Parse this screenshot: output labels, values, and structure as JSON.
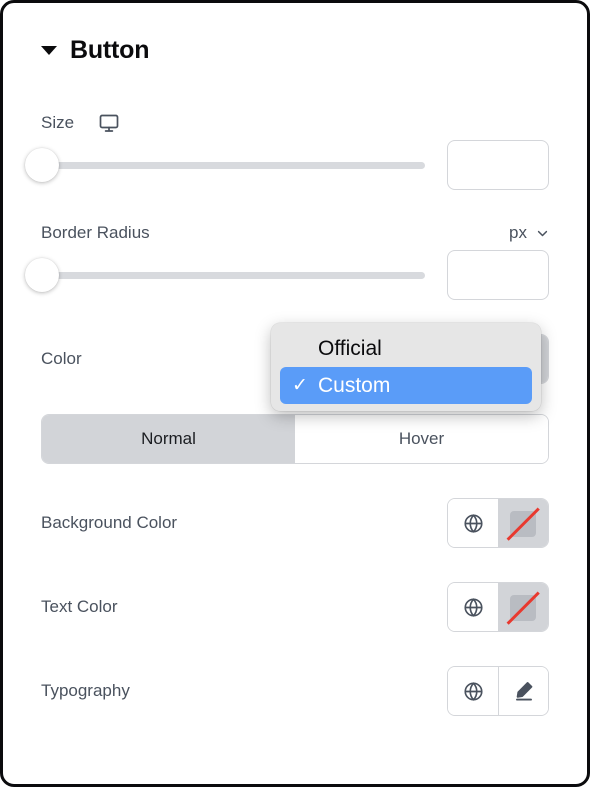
{
  "panel": {
    "title": "Button",
    "collapse_icon": "caret-down-icon"
  },
  "size": {
    "label": "Size",
    "device_icon": "desktop-monitor-icon",
    "slider_value": "",
    "slider_placeholder": "",
    "slider_percent": 0
  },
  "border_radius": {
    "label": "Border Radius",
    "unit": "px",
    "unit_chevron_icon": "chevron-down-icon",
    "slider_value": "",
    "slider_placeholder": "",
    "slider_percent": 0
  },
  "color": {
    "label": "Color",
    "globe_icon": "globe-icon",
    "swatch_icon": "no-color-swatch-icon"
  },
  "state_tabs": {
    "items": [
      {
        "label": "Normal",
        "active": true
      },
      {
        "label": "Hover",
        "active": false
      }
    ]
  },
  "background_color": {
    "label": "Background Color",
    "globe_icon": "globe-icon",
    "swatch_icon": "no-color-swatch-icon"
  },
  "text_color": {
    "label": "Text Color",
    "globe_icon": "globe-icon",
    "swatch_icon": "no-color-swatch-icon"
  },
  "typography": {
    "label": "Typography",
    "globe_icon": "globe-icon",
    "edit_icon": "pencil-edit-icon"
  },
  "dropdown": {
    "options": [
      {
        "label": "Official",
        "selected": false
      },
      {
        "label": "Custom",
        "selected": true,
        "check": "✓"
      }
    ]
  },
  "colors": {
    "accent_blue": "#5a9cf8",
    "label_text": "#4a525e",
    "track_gray": "#d8dade",
    "tab_active_bg": "#d2d4d8",
    "no_color_red": "#e8392f",
    "frame_border": "#0b0b0d"
  }
}
